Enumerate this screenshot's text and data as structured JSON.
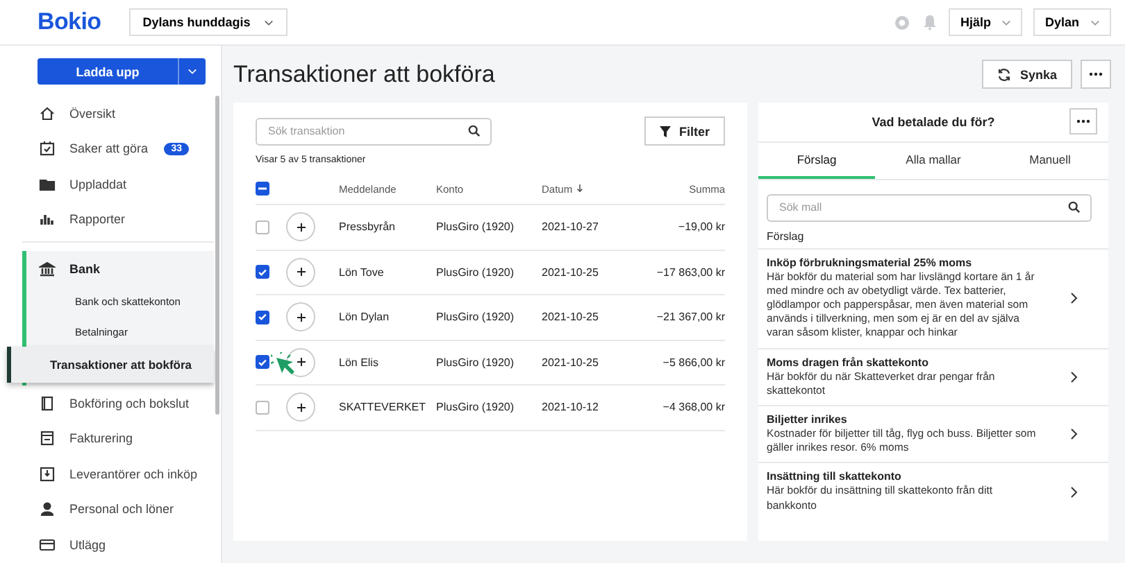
{
  "topbar": {
    "logo": "Bokio",
    "company": "Dylans hunddagis",
    "help": "Hjälp",
    "user": "Dylan"
  },
  "sidebar": {
    "upload": "Ladda upp",
    "items": [
      {
        "label": "Översikt",
        "selected": false
      },
      {
        "label": "Saker att göra",
        "badge": "33",
        "selected": false
      },
      {
        "label": "Uppladdat",
        "selected": false
      },
      {
        "label": "Rapporter",
        "selected": false
      },
      {
        "label": "Bank",
        "selected": true,
        "children": [
          {
            "label": "Bank och skattekonton",
            "selected": false
          },
          {
            "label": "Betalningar",
            "selected": false
          },
          {
            "label": "Transaktioner att bokföra",
            "selected": true
          }
        ]
      },
      {
        "label": "Bokföring och bokslut",
        "selected": false
      },
      {
        "label": "Fakturering",
        "selected": false
      },
      {
        "label": "Leverantörer och inköp",
        "selected": false
      },
      {
        "label": "Personal och löner",
        "selected": false
      },
      {
        "label": "Utlägg",
        "selected": false
      }
    ]
  },
  "page": {
    "title": "Transaktioner att bokföra",
    "sync": "Synka"
  },
  "transactions": {
    "search": {
      "placeholder": "Sök transaktion"
    },
    "filter": "Filter",
    "count": "Visar 5 av 5 transaktioner",
    "select_all_indeterminate": true,
    "columns": [
      {
        "label": "Meddelande",
        "sorted": false
      },
      {
        "label": "Konto",
        "sorted": false
      },
      {
        "label": "Datum",
        "sorted": true
      },
      {
        "label": "Summa",
        "sorted": false
      }
    ],
    "rows": [
      {
        "message": "Pressbyrån",
        "account": "PlusGiro (1920)",
        "date": "2021-10-27",
        "amount": "−19,00 kr",
        "checked": false
      },
      {
        "message": "Lön Tove",
        "account": "PlusGiro (1920)",
        "date": "2021-10-25",
        "amount": "−17 863,00 kr",
        "checked": true
      },
      {
        "message": "Lön Dylan",
        "account": "PlusGiro (1920)",
        "date": "2021-10-25",
        "amount": "−21 367,00 kr",
        "checked": true
      },
      {
        "message": "Lön Elis",
        "account": "PlusGiro (1920)",
        "date": "2021-10-25",
        "amount": "−5 866,00 kr",
        "checked": true
      },
      {
        "message": "SKATTEVERKET",
        "account": "PlusGiro (1920)",
        "date": "2021-10-12",
        "amount": "−4 368,00 kr",
        "checked": false
      }
    ]
  },
  "templates": {
    "title": "Vad betalade du för?",
    "tabs": [
      {
        "label": "Förslag",
        "selected": true
      },
      {
        "label": "Alla mallar",
        "selected": false
      },
      {
        "label": "Manuell",
        "selected": false
      }
    ],
    "search": {
      "placeholder": "Sök mall"
    },
    "section": "Förslag",
    "items": [
      {
        "title": "Inköp förbrukningsmaterial 25% moms",
        "description": "Här bokför du material som har livslängd kortare än 1 år med mindre och av obetydligt värde. Tex batterier, glödlampor och papperspåsar, men även material som används i tillverkning, men som ej är en del av själva varan såsom klister, knappar och hinkar"
      },
      {
        "title": "Moms dragen från skattekonto",
        "description": "Här bokför du när Skatteverket drar pengar från skattekontot"
      },
      {
        "title": "Biljetter inrikes",
        "description": "Kostnader för biljetter till tåg, flyg och buss. Biljetter som gäller inrikes resor. 6% moms"
      },
      {
        "title": "Insättning till skattekonto",
        "description": "Här bokför du insättning till skattekonto från ditt bankkonto"
      }
    ]
  }
}
